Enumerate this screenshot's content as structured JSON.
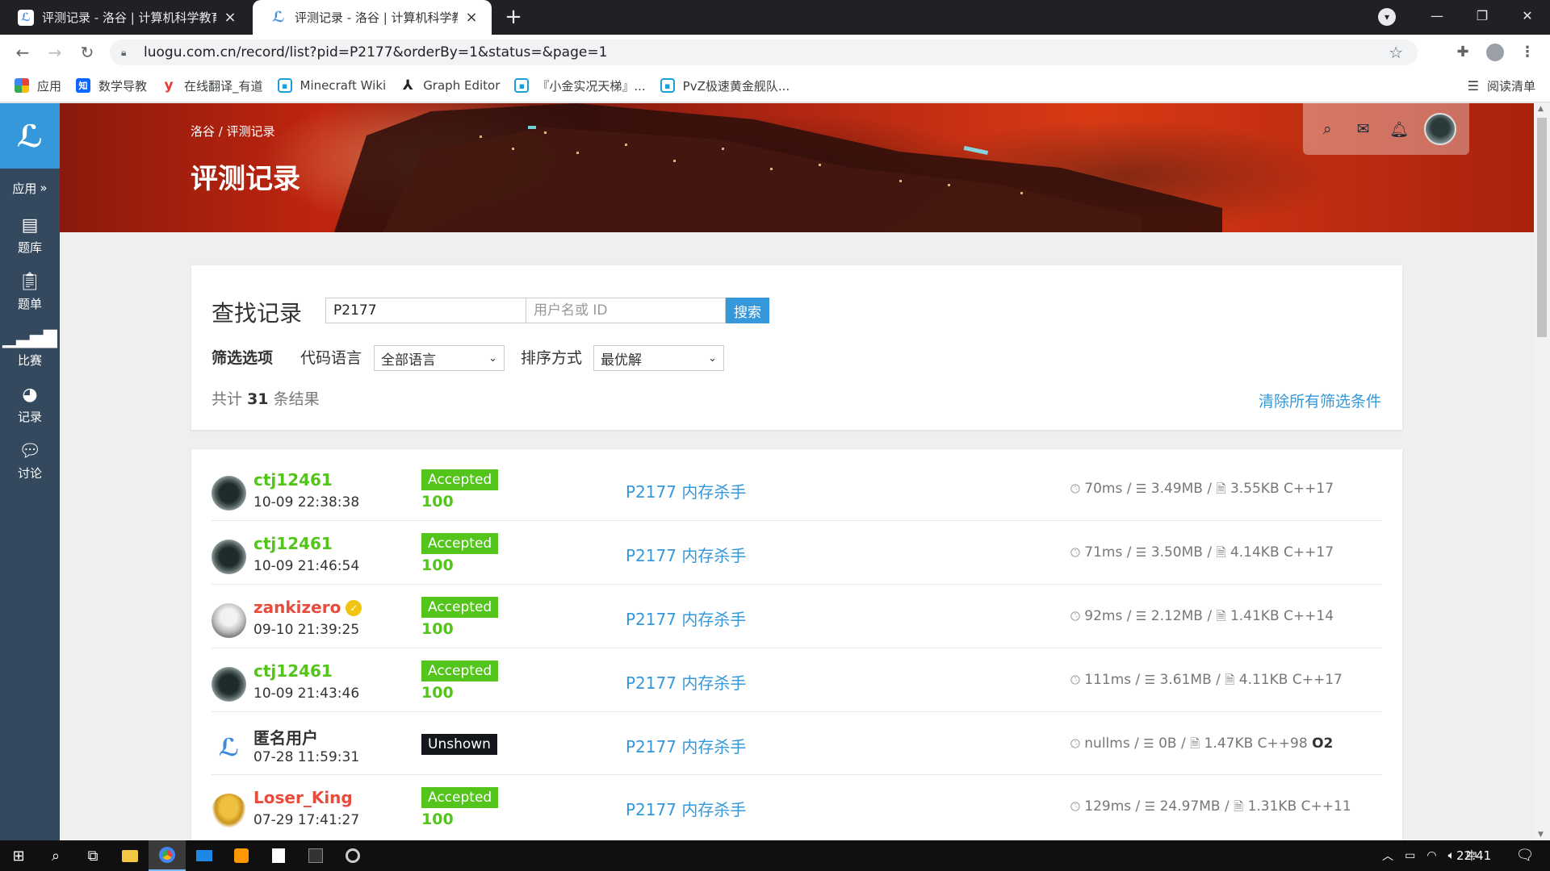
{
  "browser": {
    "tabs": [
      {
        "title": "评测记录 - 洛谷 | 计算机科学教育"
      },
      {
        "title": "评测记录 - 洛谷 | 计算机科学教育"
      }
    ],
    "new_tab": "+",
    "url": "luogu.com.cn/record/list?pid=P2177&orderBy=1&status=&page=1",
    "bookmarks": [
      {
        "label": "应用"
      },
      {
        "label": "数学导教"
      },
      {
        "label": "在线翻译_有道"
      },
      {
        "label": "Minecraft Wiki"
      },
      {
        "label": "Graph Editor"
      },
      {
        "label": "『小金实况天梯』..."
      },
      {
        "label": "PvZ极速黄金舰队..."
      }
    ],
    "reading_list": "阅读清单"
  },
  "sidebar": {
    "logo": "ℒ",
    "apps_label": "应用",
    "items": [
      {
        "label": "题库",
        "icon": "book-icon"
      },
      {
        "label": "题单",
        "icon": "clipboard-icon"
      },
      {
        "label": "比赛",
        "icon": "bar-chart-icon"
      },
      {
        "label": "记录",
        "icon": "pie-chart-icon"
      },
      {
        "label": "讨论",
        "icon": "comments-icon"
      }
    ]
  },
  "header": {
    "breadcrumb": "洛谷 / 评测记录",
    "title": "评测记录"
  },
  "search": {
    "heading": "查找记录",
    "pid_value": "P2177",
    "user_placeholder": "用户名或 ID",
    "button": "搜索",
    "filter_label": "筛选选项",
    "lang_label": "代码语言",
    "lang_value": "全部语言",
    "order_label": "排序方式",
    "order_value": "最优解",
    "total_prefix": "共计",
    "total_count": "31",
    "total_suffix": "条结果",
    "clear": "清除所有筛选条件"
  },
  "records": [
    {
      "user": "ctj12461",
      "time": "10-09 22:38:38",
      "status": "Accepted",
      "score": "100",
      "problem": "P2177 内存杀手",
      "runtime": "70ms",
      "memory": "3.49MB",
      "code": "3.55KB C++17",
      "o2": ""
    },
    {
      "user": "ctj12461",
      "time": "10-09 21:46:54",
      "status": "Accepted",
      "score": "100",
      "problem": "P2177 内存杀手",
      "runtime": "71ms",
      "memory": "3.50MB",
      "code": "4.14KB C++17",
      "o2": ""
    },
    {
      "user": "zankizero",
      "time": "09-10 21:39:25",
      "status": "Accepted",
      "score": "100",
      "problem": "P2177 内存杀手",
      "runtime": "92ms",
      "memory": "2.12MB",
      "code": "1.41KB C++14",
      "o2": ""
    },
    {
      "user": "ctj12461",
      "time": "10-09 21:43:46",
      "status": "Accepted",
      "score": "100",
      "problem": "P2177 内存杀手",
      "runtime": "111ms",
      "memory": "3.61MB",
      "code": "4.11KB C++17",
      "o2": ""
    },
    {
      "user": "匿名用户",
      "time": "07-28 11:59:31",
      "status": "Unshown",
      "score": "",
      "problem": "P2177 内存杀手",
      "runtime": "nullms",
      "memory": "0B",
      "code": "1.47KB C++98",
      "o2": "O2"
    },
    {
      "user": "Loser_King",
      "time": "07-29 17:41:27",
      "status": "Accepted",
      "score": "100",
      "problem": "P2177 内存杀手",
      "runtime": "129ms",
      "memory": "24.97MB",
      "code": "1.31KB C++11",
      "o2": ""
    }
  ],
  "taskbar": {
    "clock": "22:41",
    "ime": "中"
  },
  "colors": {
    "accent": "#3498db",
    "accepted": "#52c41a",
    "sidebar": "#34495e",
    "username_red": "#e74c3c"
  }
}
